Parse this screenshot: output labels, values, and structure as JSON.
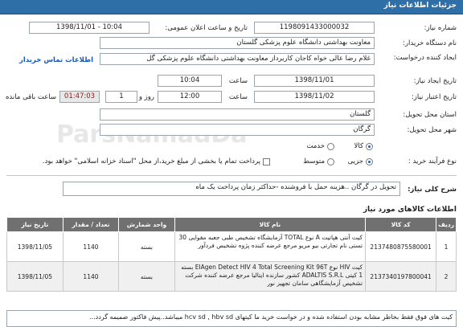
{
  "header": {
    "title": "جزئیات اطلاعات نیاز"
  },
  "form": {
    "need_number": {
      "label": "شماره نیاز:",
      "value": "1198091433000032"
    },
    "announce_datetime": {
      "label": "تاریخ و ساعت اعلان عمومی:",
      "value": "1398/11/01 - 10:04"
    },
    "buyer_org": {
      "label": "نام دستگاه خریدار:",
      "value": "معاونت بهداشتی دانشگاه علوم پزشکی گلستان"
    },
    "requester": {
      "label": "ایجاد کننده درخواست:",
      "value": "غلام رضا عالی خواه کاجان کاربرداز معاونت بهداشتی دانشگاه علوم پزشکی گل",
      "link": "اطلاعات تماس خریدار"
    },
    "created": {
      "label": "تاریخ ایجاد نیاز:",
      "date": "1398/11/01",
      "time_label": "ساعت",
      "time": "10:04"
    },
    "reply_deadline": {
      "label": "تاریخ اعتبار نیاز:",
      "date": "1398/11/02",
      "time_label": "ساعت",
      "time": "12:00",
      "days": "1",
      "days_label": "روز و",
      "remaining": "01:47:03",
      "remaining_label": "ساعت باقی مانده"
    },
    "province": {
      "label": "استان محل تحویل:",
      "value": "گلستان"
    },
    "city": {
      "label": "شهر محل تحویل:",
      "value": "گرگان"
    },
    "purchase_type": {
      "label": "نوع فرآیند خرید :",
      "options": [
        "جزیی",
        "متوسط"
      ],
      "selected": "جزیی",
      "treasury_note": "پرداخت تمام یا بخشی از مبلغ خرید،از محل \"اسناد خزانه اسلامی\" خواهد بود."
    },
    "category": {
      "options": [
        "کالا",
        "خدمت"
      ],
      "selected": "کالا"
    }
  },
  "description": {
    "label": "شرح کلی نیاز:",
    "value": "تحویل در گرگان ..هزینه حمل با فروشنده -حداکثر زمان پرداخت یک ماه"
  },
  "goods": {
    "section_title": "اطلاعات کالاهای مورد نیاز",
    "columns": [
      "ردیف",
      "کد کالا",
      "نام کالا",
      "واحد شمارش",
      "تعداد / مقدار",
      "تاریخ نیاز"
    ],
    "rows": [
      {
        "index": "1",
        "code": "2137480875580001",
        "name": "کیت آنتی هپاتیت A نوع TOTAL آزمایشگاه تشخیص طبی جعبه مقوایی 30 تستی نام تجارتی بیو مریو مرجع عرضه کننده پژوه تشخیص فردآور",
        "unit": "بسته",
        "qty": "1140",
        "date": "1398/11/05"
      },
      {
        "index": "2",
        "code": "2137340197800041",
        "name": "کیت HIV نوع EIAgen Detect HIV 4 Total Screening Kit 96T بسته 1 کیتی ADALTIS S.R.L کشور سازنده ایتالیا مرجع عرضه کننده شرکت تشخیص آزمایشگاهی سامان تجهیز نور",
        "unit": "بسته",
        "qty": "1140",
        "date": "1398/11/05"
      }
    ]
  },
  "buyer_note": "کیت های فوق فقط بخاطر مشابه بودن استفاده شده و در خواست خرید ما کیتهای hcv sd , hbv sd میباشد..پیش فاکتور ضمیمه گردد..."
}
